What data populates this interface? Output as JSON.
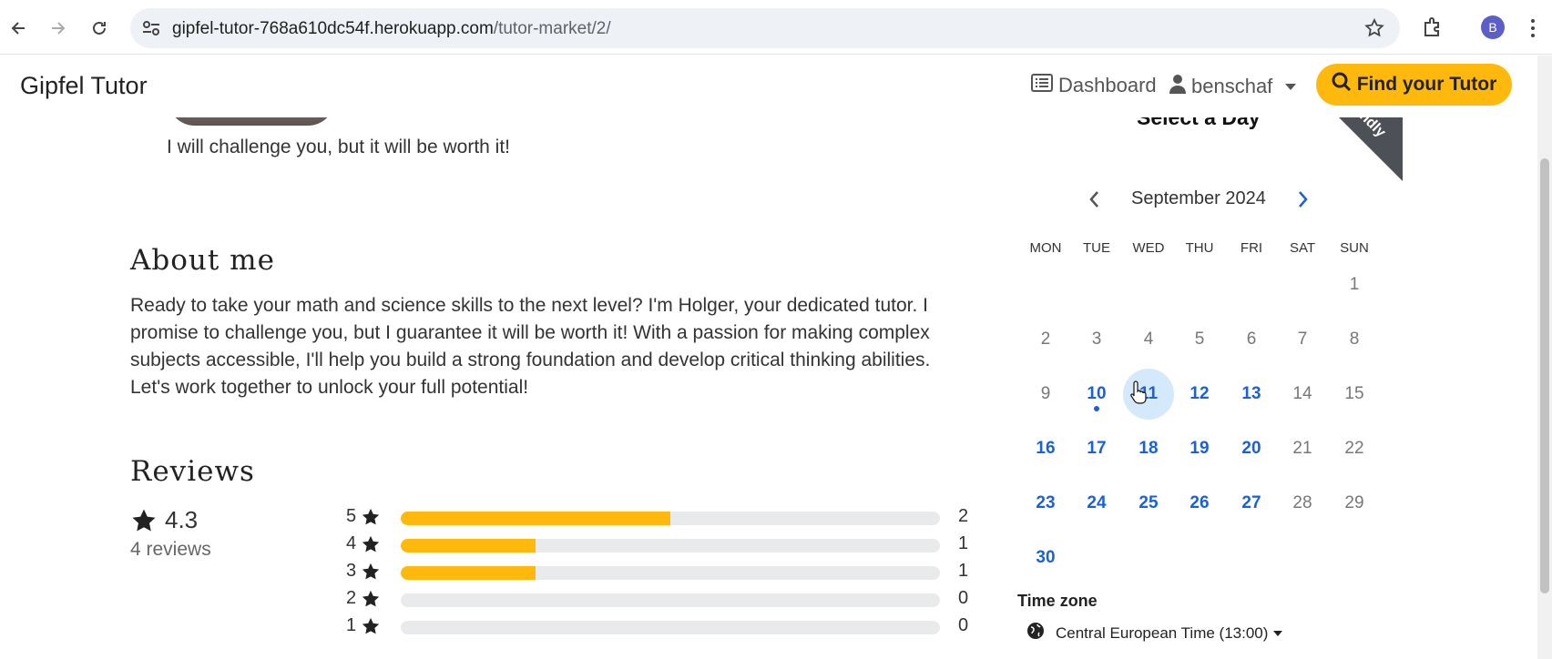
{
  "browser": {
    "url_host": "gipfel-tutor-768a610dc54f.herokuapp.com",
    "url_path": "/tutor-market/2/",
    "profile_initial": "B"
  },
  "navbar": {
    "brand": "Gipfel Tutor",
    "dashboard_label": "Dashboard",
    "user_label": "benschaf",
    "find_button_label": "Find your Tutor"
  },
  "profile": {
    "tagline": "I will challenge you, but it will be worth it!",
    "about_title": "About me",
    "about_text": "Ready to take your math and science skills to the next level? I'm Holger, your dedicated tutor. I promise to challenge you, but I guarantee it will be worth it! With a passion for making complex subjects accessible, I'll help you build a strong foundation and develop critical thinking abilities. Let's work together to unlock your full potential!"
  },
  "reviews": {
    "title": "Reviews",
    "average": "4.3",
    "count_label": "4 reviews",
    "rows": [
      {
        "stars": "5",
        "count": "2",
        "fraction": 0.5
      },
      {
        "stars": "4",
        "count": "1",
        "fraction": 0.25
      },
      {
        "stars": "3",
        "count": "1",
        "fraction": 0.25
      },
      {
        "stars": "2",
        "count": "0",
        "fraction": 0
      },
      {
        "stars": "1",
        "count": "0",
        "fraction": 0
      }
    ]
  },
  "calendar": {
    "heading": "Select a Day",
    "ribbon": "ndly",
    "month_label": "September 2024",
    "weekdays": [
      "MON",
      "TUE",
      "WED",
      "THU",
      "FRI",
      "SAT",
      "SUN"
    ],
    "weeks": [
      [
        null,
        null,
        null,
        null,
        null,
        null,
        {
          "d": "1",
          "avail": false
        }
      ],
      [
        {
          "d": "2",
          "avail": false
        },
        {
          "d": "3",
          "avail": false
        },
        {
          "d": "4",
          "avail": false
        },
        {
          "d": "5",
          "avail": false
        },
        {
          "d": "6",
          "avail": false
        },
        {
          "d": "7",
          "avail": false
        },
        {
          "d": "8",
          "avail": false
        }
      ],
      [
        {
          "d": "9",
          "avail": false
        },
        {
          "d": "10",
          "avail": true,
          "today": true
        },
        {
          "d": "11",
          "avail": true,
          "hover": true
        },
        {
          "d": "12",
          "avail": true
        },
        {
          "d": "13",
          "avail": true
        },
        {
          "d": "14",
          "avail": false
        },
        {
          "d": "15",
          "avail": false
        }
      ],
      [
        {
          "d": "16",
          "avail": true
        },
        {
          "d": "17",
          "avail": true
        },
        {
          "d": "18",
          "avail": true
        },
        {
          "d": "19",
          "avail": true
        },
        {
          "d": "20",
          "avail": true
        },
        {
          "d": "21",
          "avail": false
        },
        {
          "d": "22",
          "avail": false
        }
      ],
      [
        {
          "d": "23",
          "avail": true
        },
        {
          "d": "24",
          "avail": true
        },
        {
          "d": "25",
          "avail": true
        },
        {
          "d": "26",
          "avail": true
        },
        {
          "d": "27",
          "avail": true
        },
        {
          "d": "28",
          "avail": false
        },
        {
          "d": "29",
          "avail": false
        }
      ],
      [
        {
          "d": "30",
          "avail": true
        },
        null,
        null,
        null,
        null,
        null,
        null
      ]
    ],
    "timezone_label": "Time zone",
    "timezone_value": "Central European Time (13:00)"
  },
  "colors": {
    "accent": "#ffb80c",
    "link_blue": "#1a61d6"
  },
  "icons": [
    "back-icon",
    "forward-icon",
    "reload-icon",
    "site-settings-icon",
    "bookmark-star-icon",
    "extensions-icon",
    "list-icon",
    "user-icon",
    "search-icon",
    "star-icon",
    "chevron-left-icon",
    "chevron-right-icon",
    "globe-icon"
  ]
}
